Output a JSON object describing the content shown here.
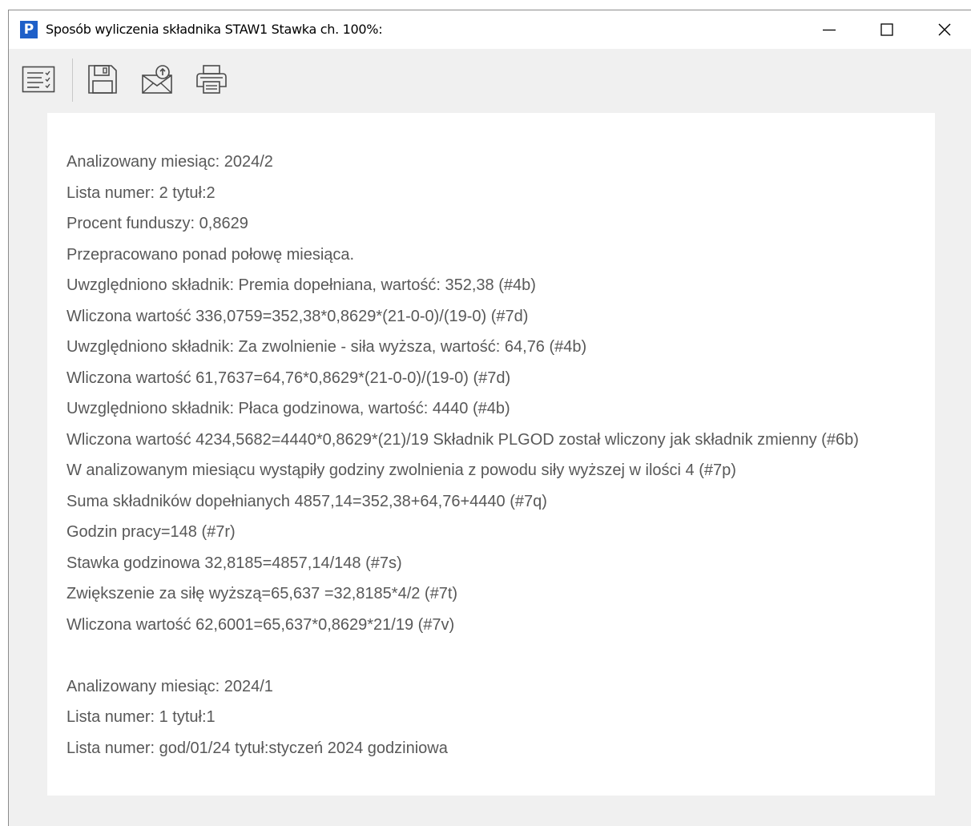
{
  "window": {
    "app_icon": "P",
    "title": "Sposób wyliczenia składnika STAW1 Stawka ch. 100%:",
    "controls": {
      "minimize": "minimize-icon",
      "maximize": "maximize-icon",
      "close": "close-icon"
    }
  },
  "toolbar": {
    "buttons": [
      {
        "name": "details-list-icon"
      },
      {
        "name": "save-icon"
      },
      {
        "name": "send-email-icon"
      },
      {
        "name": "print-icon"
      }
    ]
  },
  "content": {
    "lines": [
      "Analizowany miesiąc: 2024/2",
      "Lista numer: 2 tytuł:2",
      "Procent funduszy: 0,8629",
      "Przepracowano ponad połowę miesiąca.",
      "Uwzględniono składnik: Premia dopełniana, wartość: 352,38 (#4b)",
      "Wliczona wartość 336,0759=352,38*0,8629*(21-0-0)/(19-0) (#7d)",
      "Uwzględniono składnik: Za zwolnienie - siła wyższa, wartość: 64,76 (#4b)",
      "Wliczona wartość 61,7637=64,76*0,8629*(21-0-0)/(19-0) (#7d)",
      "Uwzględniono składnik: Płaca godzinowa, wartość: 4440 (#4b)",
      "Wliczona wartość 4234,5682=4440*0,8629*(21)/19 Składnik PLGOD został wliczony jak składnik zmienny (#6b)",
      "W analizowanym miesiącu wystąpiły godziny zwolnienia z powodu siły wyższej w ilości 4 (#7p)",
      "Suma składników dopełnianych 4857,14=352,38+64,76+4440 (#7q)",
      "Godzin pracy=148 (#7r)",
      "Stawka godzinowa 32,8185=4857,14/148 (#7s)",
      "Zwiększenie za siłę wyższą=65,637 =32,8185*4/2 (#7t)",
      "Wliczona wartość 62,6001=65,637*0,8629*21/19 (#7v)",
      "",
      "Analizowany miesiąc: 2024/1",
      "Lista numer: 1 tytuł:1",
      "Lista numer: god/01/24 tytuł:styczeń 2024 godziniowa"
    ]
  }
}
